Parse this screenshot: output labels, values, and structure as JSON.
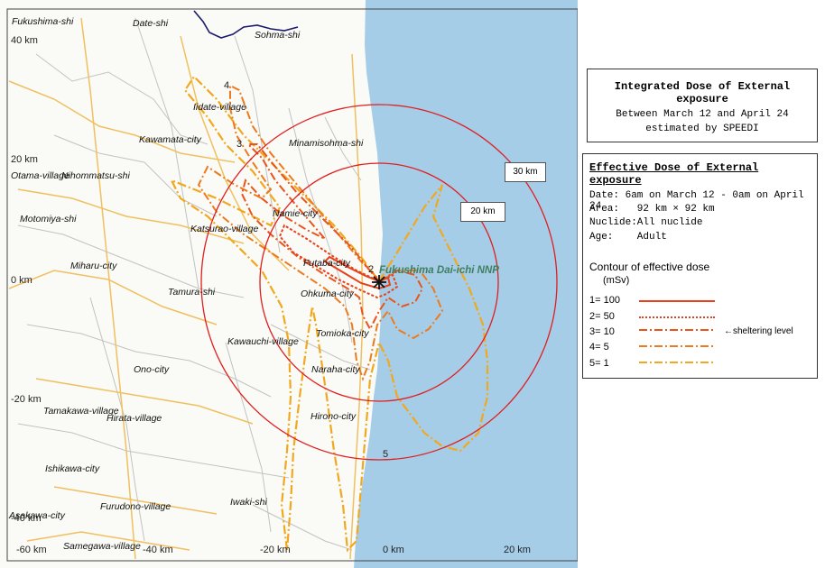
{
  "title_box": {
    "line1": "Integrated Dose of External exposure",
    "line2": "Between March 12 and April 24",
    "line3": "estimated by SPEEDI"
  },
  "legend": {
    "heading": "Effective Dose of External exposure",
    "date": "Date: 6am on March 12 - 0am on April 24",
    "area": "Area:   92 km × 92 km",
    "nuclide": "Nuclide:All nuclide",
    "age": "Age:    Adult",
    "contour_title": "Contour of effective dose",
    "contour_unit": "(mSv)",
    "levels": [
      {
        "label": "1= 100",
        "color": "#e8401c",
        "style": "solid"
      },
      {
        "label": "2= 50",
        "color": "#e8401c",
        "style": "dotted"
      },
      {
        "label": "3= 10",
        "color": "#e8541c",
        "style": "dashdot"
      },
      {
        "label": "4= 5",
        "color": "#ec7a1e",
        "style": "dashdot"
      },
      {
        "label": "5= 1",
        "color": "#f2a81e",
        "style": "dashdot"
      }
    ],
    "sheltering_note": "←sheltering level"
  },
  "callouts": {
    "r30": "30 km",
    "r20": "20 km"
  },
  "plant_label": "Fukushima Dai-ichi NNP",
  "contour_numbers": [
    "4",
    "3",
    "2",
    "5"
  ],
  "coords": {
    "y40": "40 km",
    "y20": "20 km",
    "y0": "0 km",
    "ym20": "-20 km",
    "ym40": "-40 km",
    "xm60": "-60 km",
    "xm40": "-40 km",
    "xm20": "-20 km",
    "x0": "0 km",
    "x20": "20 km"
  },
  "places": [
    "Fukushima-shi",
    "Date-shi",
    "Sohma-shi",
    "Iidate-village",
    "Minamisohma-shi",
    "Kawamata-city",
    "Otama-village",
    "Nihommatsu-shi",
    "Namie-city",
    "Motomiya-shi",
    "Katsurao-village",
    "Miharu-city",
    "Futaba-city",
    "Tamura-shi",
    "Ohkuma-city",
    "Tomioka-city",
    "Kawauchi-village",
    "Naraha-city",
    "Ono-city",
    "Tamakawa-village",
    "Hirata-village",
    "Hirono-city",
    "Ishikawa-city",
    "Furudono-village",
    "Iwaki-shi",
    "Asakawa-city",
    "Samegawa-village"
  ],
  "colors": {
    "sea": "#a6cde8",
    "land": "#fafaf6",
    "circles": "#e01e1e",
    "roads": "#f0c060",
    "borders": "#c2c2c2",
    "prefecture": "#1a1a6e"
  }
}
